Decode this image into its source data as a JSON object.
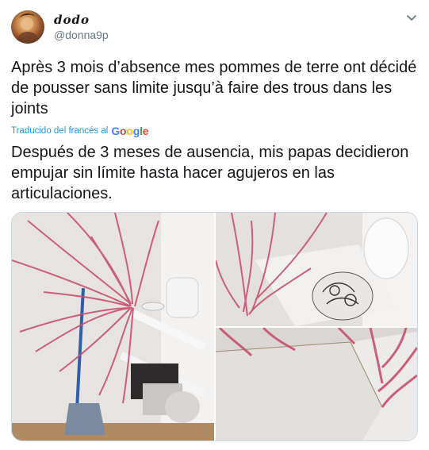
{
  "user": {
    "display_name": "dodo",
    "handle": "@donna9p"
  },
  "tweet": {
    "original_text": "Après 3 mois d’absence mes pommes de terre ont décidé de pousser sans limite jusqu’à faire des trous dans les joints",
    "translated_label": "Traducido del francés al",
    "translator_logo": [
      "G",
      "o",
      "o",
      "g",
      "l",
      "e"
    ],
    "translated_text": "Después de 3 meses de ausencia, mis papas decidieron empujar sin límite hasta hacer agujeros en las articulaciones."
  },
  "icons": {
    "caret": "chevron-down-icon"
  },
  "colors": {
    "link": "#1b95e0",
    "secondary_text": "#657786",
    "sprout": "#c8506f"
  }
}
